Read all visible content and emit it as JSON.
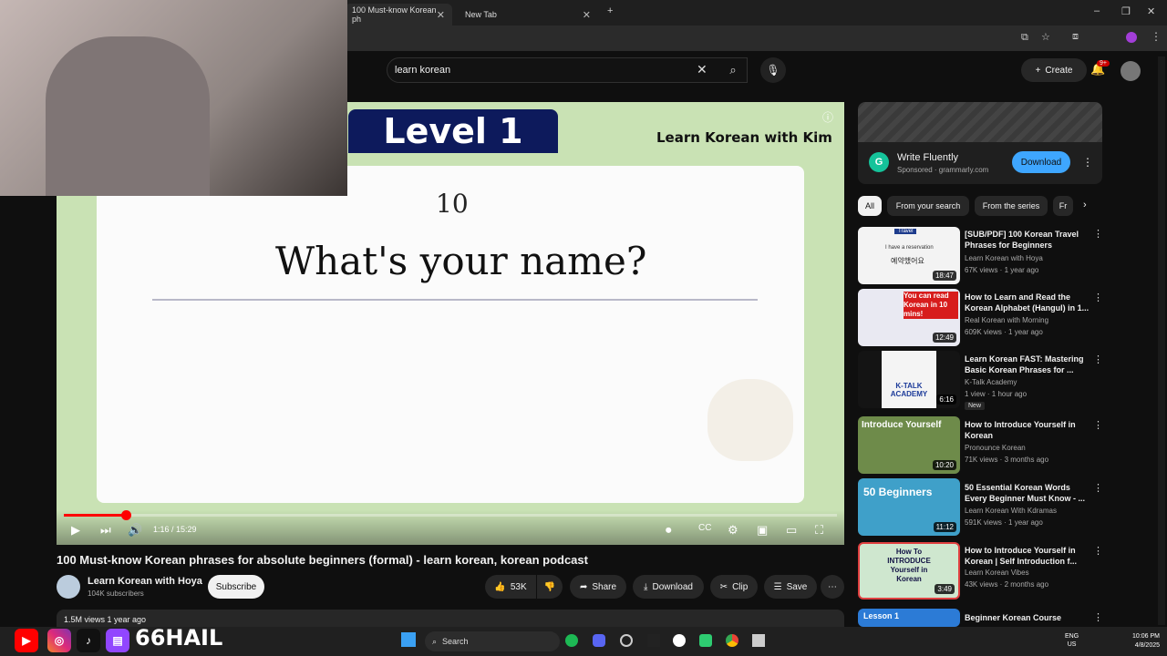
{
  "browser": {
    "tabs": [
      {
        "label": "100 Must-know Korean ph",
        "active": true
      },
      {
        "label": "New Tab",
        "active": false
      }
    ]
  },
  "header": {
    "search_value": "learn korean",
    "create_label": "Create",
    "notifications_badge": "9+"
  },
  "video": {
    "slide_level": "Level 1",
    "slide_brand": "Learn Korean with Kim",
    "slide_number": "10",
    "slide_phrase": "What's your name?",
    "timecode": "1:16 / 15:29",
    "progress_fraction": 0.08
  },
  "details": {
    "title": "100 Must-know Korean phrases for absolute beginners (formal) - learn korean, korean podcast",
    "channel_name": "Learn Korean with Hoya",
    "channel_subs": "104K subscribers",
    "subscribe_label": "Subscribe",
    "likes": "53K",
    "share_label": "Share",
    "download_label": "Download",
    "clip_label": "Clip",
    "save_label": "Save",
    "views_meta": "1.5M views  1 year ago"
  },
  "ad": {
    "title": "Write Fluently",
    "sponsored": "Sponsored",
    "domain": "grammarly.com",
    "sub": "Sponsored · grammarly.com",
    "button": "Download",
    "icon_letter": "G"
  },
  "chips": [
    "All",
    "From your search",
    "From the series",
    "Fr"
  ],
  "recommendations": [
    {
      "title": "[SUB/PDF] 100 Korean Travel Phrases for Beginners",
      "channel": "Learn Korean with Hoya",
      "meta": "67K views · 1 year ago",
      "duration": "18:47",
      "thumb_color": "#f3f3f3"
    },
    {
      "title": "How to Learn and Read the Korean Alphabet (Hangul) in 1...",
      "channel": "Real Korean with Morning",
      "meta": "609K views · 1 year ago",
      "duration": "12:49",
      "thumb_color": "#e9e9f2"
    },
    {
      "title": "Learn Korean FAST: Mastering Basic Korean Phrases for ...",
      "channel": "K-Talk Academy",
      "meta": "1 view · 1 hour ago",
      "badge": "New",
      "duration": "6:16",
      "thumb_color": "#f4f4f4"
    },
    {
      "title": "How to Introduce Yourself in Korean",
      "channel": "Pronounce Korean",
      "meta": "71K views · 3 months ago",
      "duration": "10:20",
      "thumb_color": "#6e8b4a"
    },
    {
      "title": "50 Essential Korean Words Every Beginner Must Know - ...",
      "channel": "Learn Korean With Kdramas",
      "meta": "591K views · 1 year ago",
      "duration": "11:12",
      "thumb_color": "#3fa0c9"
    },
    {
      "title": "How to Introduce Yourself in Korean | Self Introduction f...",
      "channel": "Learn Korean Vibes",
      "meta": "43K views · 2 months ago",
      "duration": "3:49",
      "thumb_color": "#cfe7cf"
    },
    {
      "title": "Beginner Korean Course",
      "channel": "",
      "meta": "",
      "duration": "",
      "thumb_color": "#2c7bd6"
    }
  ],
  "thumb_text": {
    "t1_top": "Travel",
    "t1_line": "I have a reservation",
    "t1_ko": "예약했어요",
    "t2": "You can read Korean in 10 mins!",
    "t3": "K-TALK ACADEMY",
    "t4": "Introduce Yourself",
    "t5": "50 Beginners",
    "t6": "How To INTRODUCE Yourself in Korean",
    "t7": "Lesson 1"
  },
  "taskbar": {
    "search_label": "Search",
    "overlay_tag": "66HAIL",
    "lang_top": "ENG",
    "lang_bottom": "US",
    "time": "10:06 PM",
    "date": "4/8/2025"
  }
}
